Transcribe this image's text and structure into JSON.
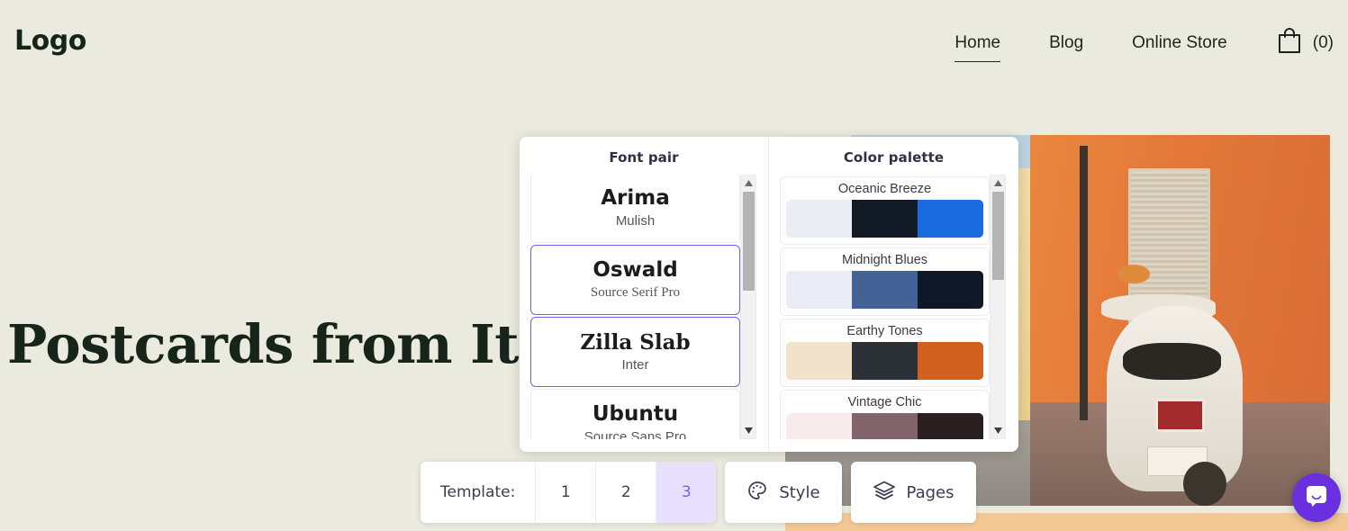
{
  "site": {
    "logo": "Logo",
    "nav": [
      {
        "label": "Home",
        "active": true
      },
      {
        "label": "Blog",
        "active": false
      },
      {
        "label": "Online Store",
        "active": false
      }
    ],
    "cart": {
      "icon": "shopping-bag-icon",
      "count": "(0)"
    },
    "hero_title": "Postcards from Ita",
    "background_color": "#eaeade",
    "text_color": "#16241a"
  },
  "style_panel": {
    "font_pair": {
      "title": "Font pair",
      "items": [
        {
          "primary": "Arima",
          "secondary": "Mulish",
          "selected": false
        },
        {
          "primary": "Oswald",
          "secondary": "Source Serif Pro",
          "selected": true
        },
        {
          "primary": "Zilla Slab",
          "secondary": "Inter",
          "selected": true
        },
        {
          "primary": "Ubuntu",
          "secondary": "Source Sans Pro",
          "selected": false
        }
      ]
    },
    "color_palette": {
      "title": "Color palette",
      "items": [
        {
          "name": "Oceanic Breeze",
          "colors": [
            "#eaedf2",
            "#121a26",
            "#1a6ae0"
          ]
        },
        {
          "name": "Midnight Blues",
          "colors": [
            "#e9ecf5",
            "#436296",
            "#101727"
          ]
        },
        {
          "name": "Earthy Tones",
          "colors": [
            "#f2e2cc",
            "#2b3136",
            "#d2611f"
          ]
        },
        {
          "name": "Vintage Chic",
          "colors": [
            "#f8ebeb",
            "#81646c",
            "#2a1f20"
          ]
        }
      ]
    },
    "selected_accent": "#7b5cf0"
  },
  "toolbar": {
    "template_label": "Template:",
    "templates": [
      {
        "label": "1",
        "active": false
      },
      {
        "label": "2",
        "active": false
      },
      {
        "label": "3",
        "active": true
      }
    ],
    "style_button": "Style",
    "pages_button": "Pages"
  },
  "widgets": {
    "intercom_color": "#6a30e0"
  }
}
